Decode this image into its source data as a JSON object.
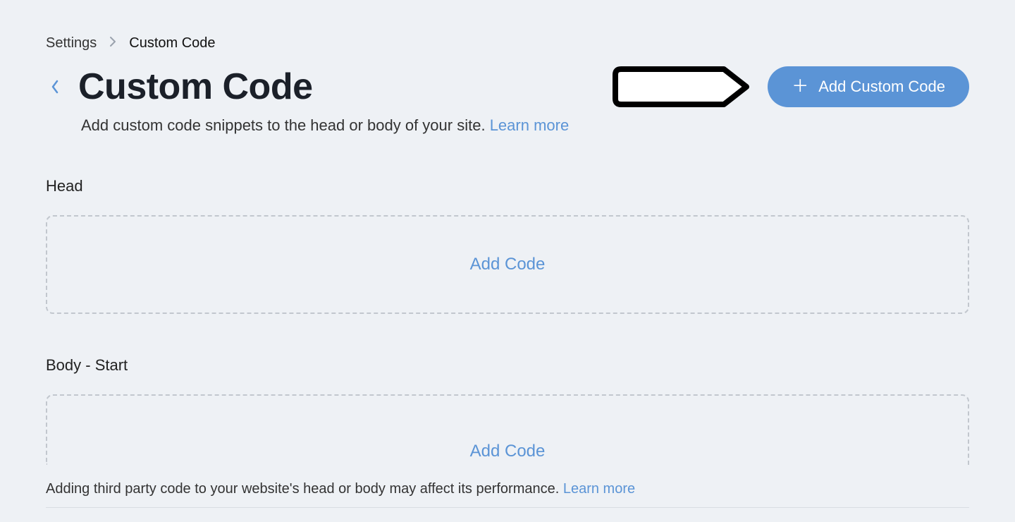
{
  "breadcrumb": {
    "root": "Settings",
    "current": "Custom Code"
  },
  "header": {
    "title": "Custom Code",
    "subtitle_text": "Add custom code snippets to the head or body of your site. ",
    "learn_more": "Learn more",
    "add_button": "Add Custom Code"
  },
  "sections": {
    "head": {
      "label": "Head",
      "cta": "Add Code"
    },
    "body_start": {
      "label": "Body - Start",
      "cta": "Add Code"
    }
  },
  "footer": {
    "text": "Adding third party code to your website's head or body may affect its performance. ",
    "learn_more": "Learn more"
  }
}
